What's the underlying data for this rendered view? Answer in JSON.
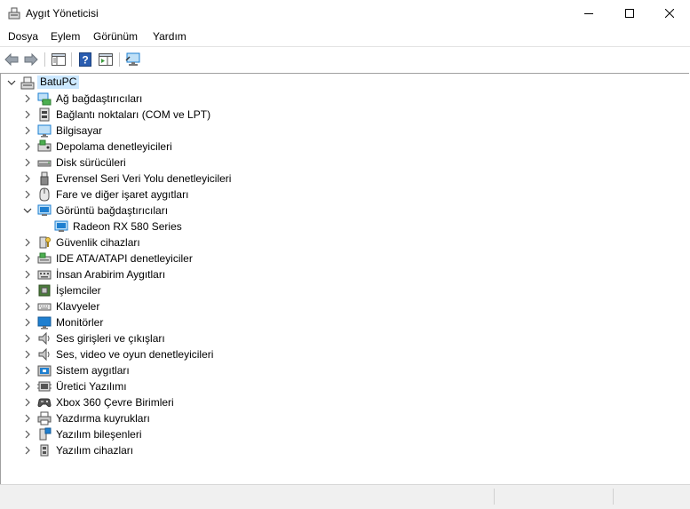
{
  "window": {
    "title": "Aygıt Yöneticisi"
  },
  "menu": {
    "items": [
      "Dosya",
      "Eylem",
      "Görünüm",
      "Yardım"
    ]
  },
  "tree": {
    "root": {
      "label": "BatuPC",
      "expanded": true
    },
    "categories": [
      {
        "label": "Ağ bağdaştırıcıları",
        "icon": "network-adapter-icon",
        "expanded": false
      },
      {
        "label": "Bağlantı noktaları (COM ve LPT)",
        "icon": "port-icon",
        "expanded": false
      },
      {
        "label": "Bilgisayar",
        "icon": "computer-icon",
        "expanded": false
      },
      {
        "label": "Depolama denetleyicileri",
        "icon": "storage-controller-icon",
        "expanded": false
      },
      {
        "label": "Disk sürücüleri",
        "icon": "disk-drive-icon",
        "expanded": false
      },
      {
        "label": "Evrensel Seri Veri Yolu denetleyicileri",
        "icon": "usb-icon",
        "expanded": false
      },
      {
        "label": "Fare ve diğer işaret aygıtları",
        "icon": "mouse-icon",
        "expanded": false
      },
      {
        "label": "Görüntü bağdaştırıcıları",
        "icon": "display-adapter-icon",
        "expanded": true,
        "children": [
          {
            "label": "Radeon RX 580 Series",
            "icon": "display-adapter-icon"
          }
        ]
      },
      {
        "label": "Güvenlik cihazları",
        "icon": "security-device-icon",
        "expanded": false
      },
      {
        "label": "IDE ATA/ATAPI denetleyiciler",
        "icon": "ide-controller-icon",
        "expanded": false
      },
      {
        "label": "İnsan Arabirim Aygıtları",
        "icon": "hid-icon",
        "expanded": false
      },
      {
        "label": "İşlemciler",
        "icon": "processor-icon",
        "expanded": false
      },
      {
        "label": "Klavyeler",
        "icon": "keyboard-icon",
        "expanded": false
      },
      {
        "label": "Monitörler",
        "icon": "monitor-icon",
        "expanded": false
      },
      {
        "label": "Ses girişleri ve çıkışları",
        "icon": "speaker-icon",
        "expanded": false
      },
      {
        "label": "Ses, video ve oyun denetleyicileri",
        "icon": "speaker-icon",
        "expanded": false
      },
      {
        "label": "Sistem aygıtları",
        "icon": "system-device-icon",
        "expanded": false
      },
      {
        "label": "Üretici Yazılımı",
        "icon": "firmware-icon",
        "expanded": false
      },
      {
        "label": "Xbox 360 Çevre Birimleri",
        "icon": "gamepad-icon",
        "expanded": false
      },
      {
        "label": "Yazdırma kuyrukları",
        "icon": "printer-icon",
        "expanded": false
      },
      {
        "label": "Yazılım bileşenleri",
        "icon": "software-component-icon",
        "expanded": false
      },
      {
        "label": "Yazılım cihazları",
        "icon": "software-device-icon",
        "expanded": false
      }
    ]
  },
  "colors": {
    "selection": "#cce8ff",
    "monitor_blue": "#1e7fd0",
    "help_blue": "#2a5db0"
  }
}
